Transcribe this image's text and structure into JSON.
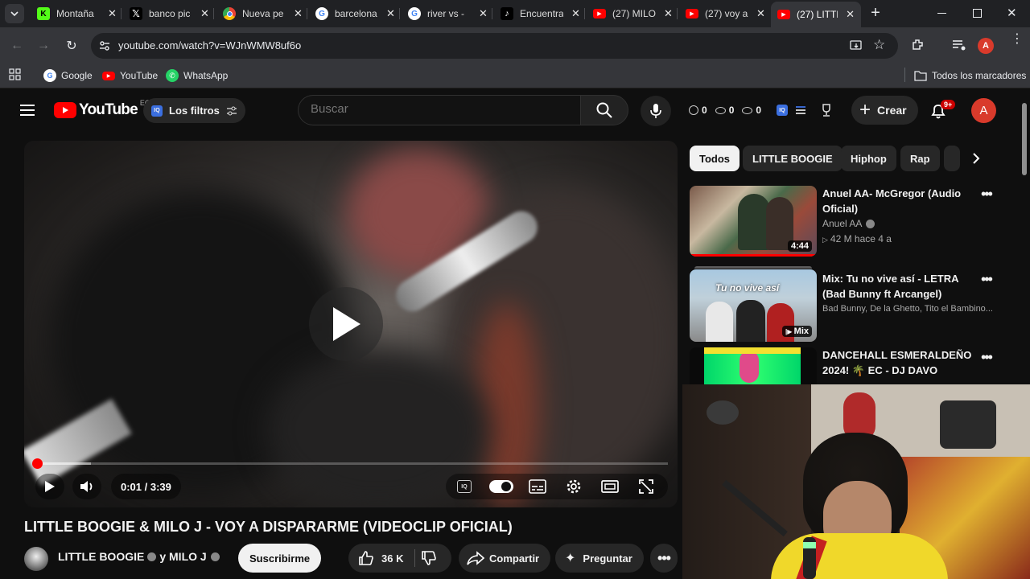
{
  "browser": {
    "tabs": [
      {
        "title": "Montaña",
        "favicon": "kick-icon",
        "color": "#53fc18"
      },
      {
        "title": "banco pic",
        "favicon": "x-icon",
        "color": "#000000"
      },
      {
        "title": "Nueva pe",
        "favicon": "chrome-icon",
        "color": "#4285f4"
      },
      {
        "title": "barcelona",
        "favicon": "google-icon",
        "color": "#ffffff"
      },
      {
        "title": "river vs -",
        "favicon": "google-icon",
        "color": "#ffffff"
      },
      {
        "title": "Encuentra",
        "favicon": "tiktok-icon",
        "color": "#000000"
      },
      {
        "title": "(27) MILO",
        "favicon": "youtube-icon",
        "color": "#ff0000"
      },
      {
        "title": "(27) voy a",
        "favicon": "youtube-icon",
        "color": "#ff0000"
      },
      {
        "title": "(27) LITTL",
        "favicon": "youtube-icon",
        "color": "#ff0000"
      }
    ],
    "new_tab": "+",
    "url": "youtube.com/watch?v=WJnWMW8uf6o",
    "bookmarks": [
      {
        "label": "Google",
        "icon": "google-icon"
      },
      {
        "label": "YouTube",
        "icon": "youtube-icon"
      },
      {
        "label": "WhatsApp",
        "icon": "whatsapp-icon"
      }
    ],
    "all_bookmarks": "Todos los marcadores",
    "profile_initial": "A"
  },
  "youtube": {
    "logo_text": "YouTube",
    "country": "EC",
    "filters_label": "Los filtros",
    "search_placeholder": "Buscar",
    "stats": [
      "0",
      "0",
      "0"
    ],
    "create_label": "Crear",
    "notif_badge": "9+",
    "avatar_initial": "A"
  },
  "player": {
    "time": "0:01 / 3:39",
    "progress_fraction": 0.005,
    "buffer_fraction": 0.09
  },
  "video": {
    "title": "LITTLE BOOGIE & MILO J - VOY A DISPARARME (VIDEOCLIP OFICIAL)",
    "channel": "LITTLE BOOGIE",
    "channel_join": "y MILO J",
    "subscribe_label": "Suscribirme",
    "likes": "36 K",
    "share_label": "Compartir",
    "ask_label": "Preguntar"
  },
  "chips": [
    "Todos",
    "LITTLE BOOGIE",
    "Hiphop",
    "Rap"
  ],
  "recommendations": [
    {
      "title": "Anuel AA-  McGregor (Audio Oficial)",
      "channel": "Anuel AA",
      "meta": "42 M   hace 4 a",
      "badge": "4:44"
    },
    {
      "title": "Mix: Tu no vive así - LETRA (Bad Bunny ft Arcangel)",
      "channel": "Bad Bunny, De la Ghetto, Tito el Bambino...",
      "meta": "",
      "badge": "Mix",
      "thumb_text": "Tu no vive así"
    },
    {
      "title": "DANCEHALL ESMERALDEÑO 2024! 🌴 EC - DJ DAVO",
      "channel": "",
      "meta": "",
      "badge": ""
    }
  ]
}
